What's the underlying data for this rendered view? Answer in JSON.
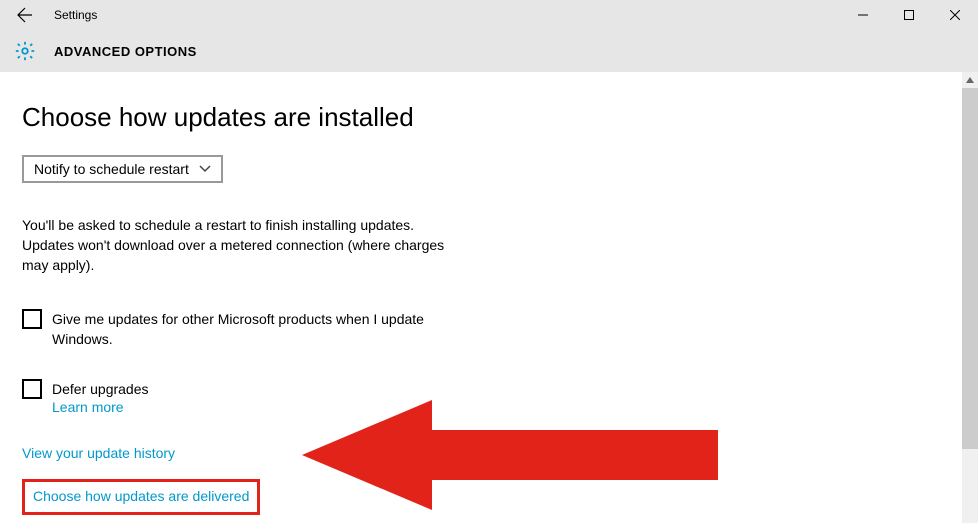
{
  "window": {
    "app_title": "Settings",
    "page_header": "ADVANCED OPTIONS"
  },
  "main": {
    "section_title": "Choose how updates are installed",
    "dropdown_value": "Notify to schedule restart",
    "description": "You'll be asked to schedule a restart to finish installing updates. Updates won't download over a metered connection (where charges may apply).",
    "checkbox_other_products": "Give me updates for other Microsoft products when I update Windows.",
    "defer_label": "Defer upgrades",
    "learn_more": "Learn more",
    "history_link": "View your update history",
    "delivery_link": "Choose how updates are delivered"
  }
}
